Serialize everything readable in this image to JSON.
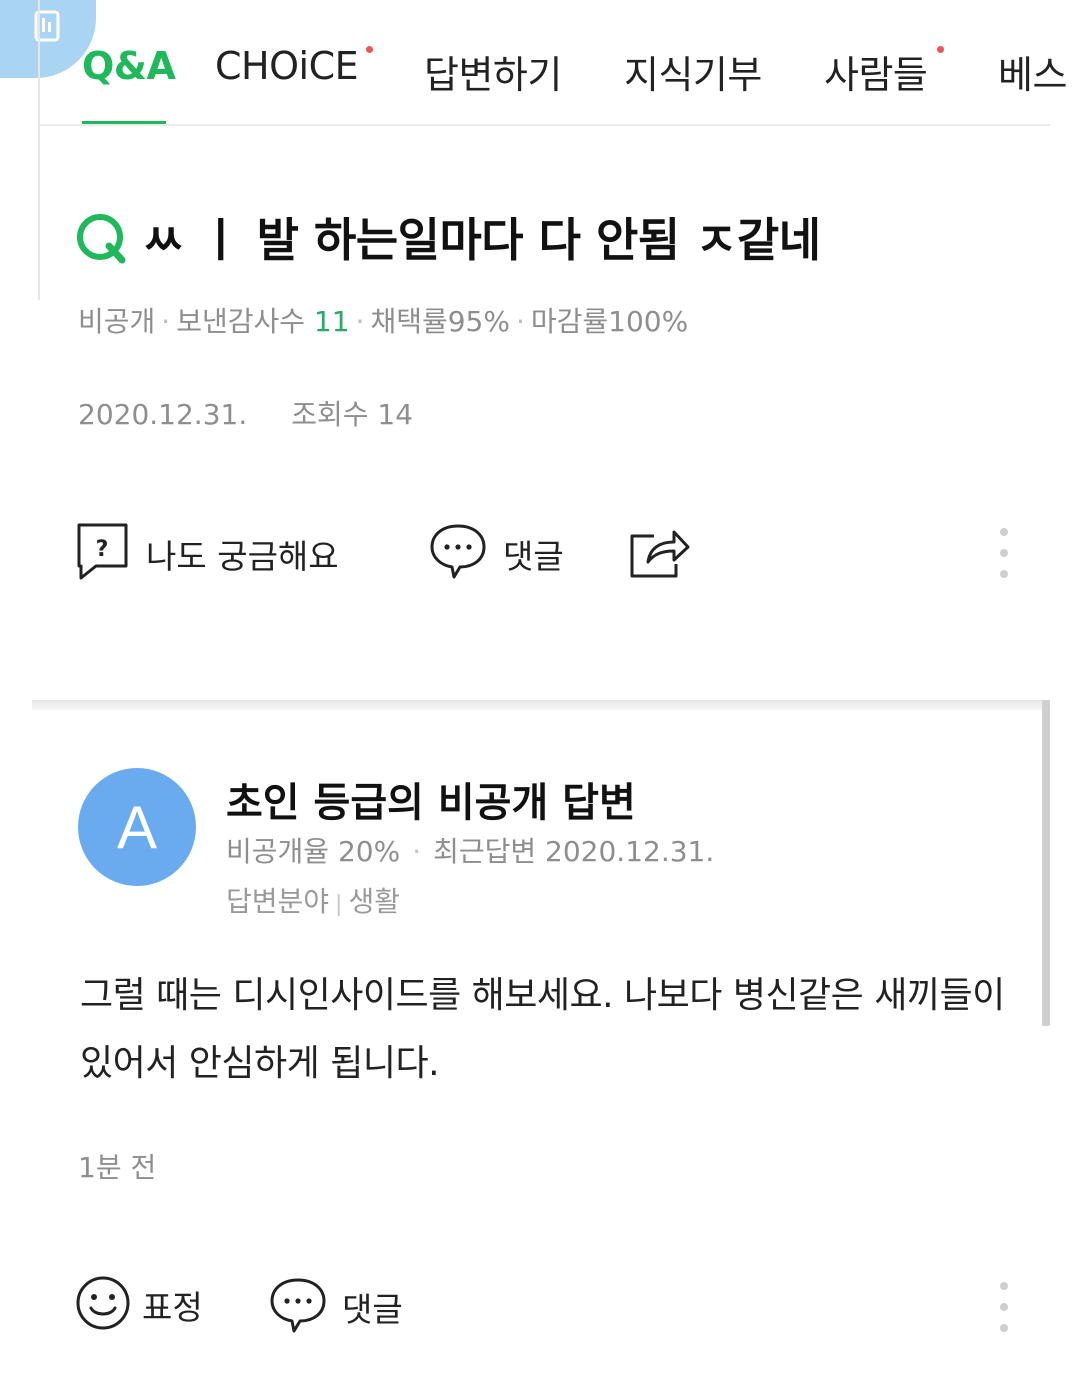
{
  "tabs": [
    {
      "label": "Q&A",
      "active": true
    },
    {
      "label": "CHOiCE",
      "has_dot": true
    },
    {
      "label": "답변하기"
    },
    {
      "label": "지식기부"
    },
    {
      "label": "사람들",
      "has_dot": true
    },
    {
      "label": "베스"
    }
  ],
  "question": {
    "mark": "Q",
    "title": "ㅆ ㅣ 발 하는일마다 다 안됨 ㅈ같네",
    "meta": {
      "visibility": "비공개",
      "thanks_label": "보낸감사수",
      "thanks_count": "11",
      "adopt_rate": "채택률95%",
      "close_rate": "마감률100%"
    },
    "date": "2020.12.31.",
    "views": "조회수 14",
    "actions": {
      "curious_label": "나도 궁금해요",
      "comment_label": "댓글"
    }
  },
  "answer": {
    "avatar_letter": "A",
    "name": "초인 등급의 비공개 답변",
    "private_rate": "비공개율 20%",
    "recent_answer": "최근답변 2020.12.31.",
    "field_label": "답변분야",
    "field_value": "생활",
    "body": "그럴 때는 디시인사이드를 해보세요. 나보다 병신같은 새끼들이 있어서 안심하게 됩니다.",
    "time": "1분 전",
    "actions": {
      "emotion_label": "표정",
      "comment_label": "댓글"
    }
  },
  "colors": {
    "accent_green": "#1fb85a",
    "avatar_blue": "#6aabef",
    "notify_dot": "#f25454"
  },
  "icons": [
    "app-icon",
    "question-bubble-icon",
    "comment-bubble-icon",
    "share-icon",
    "more-vertical-icon",
    "smiley-icon"
  ]
}
